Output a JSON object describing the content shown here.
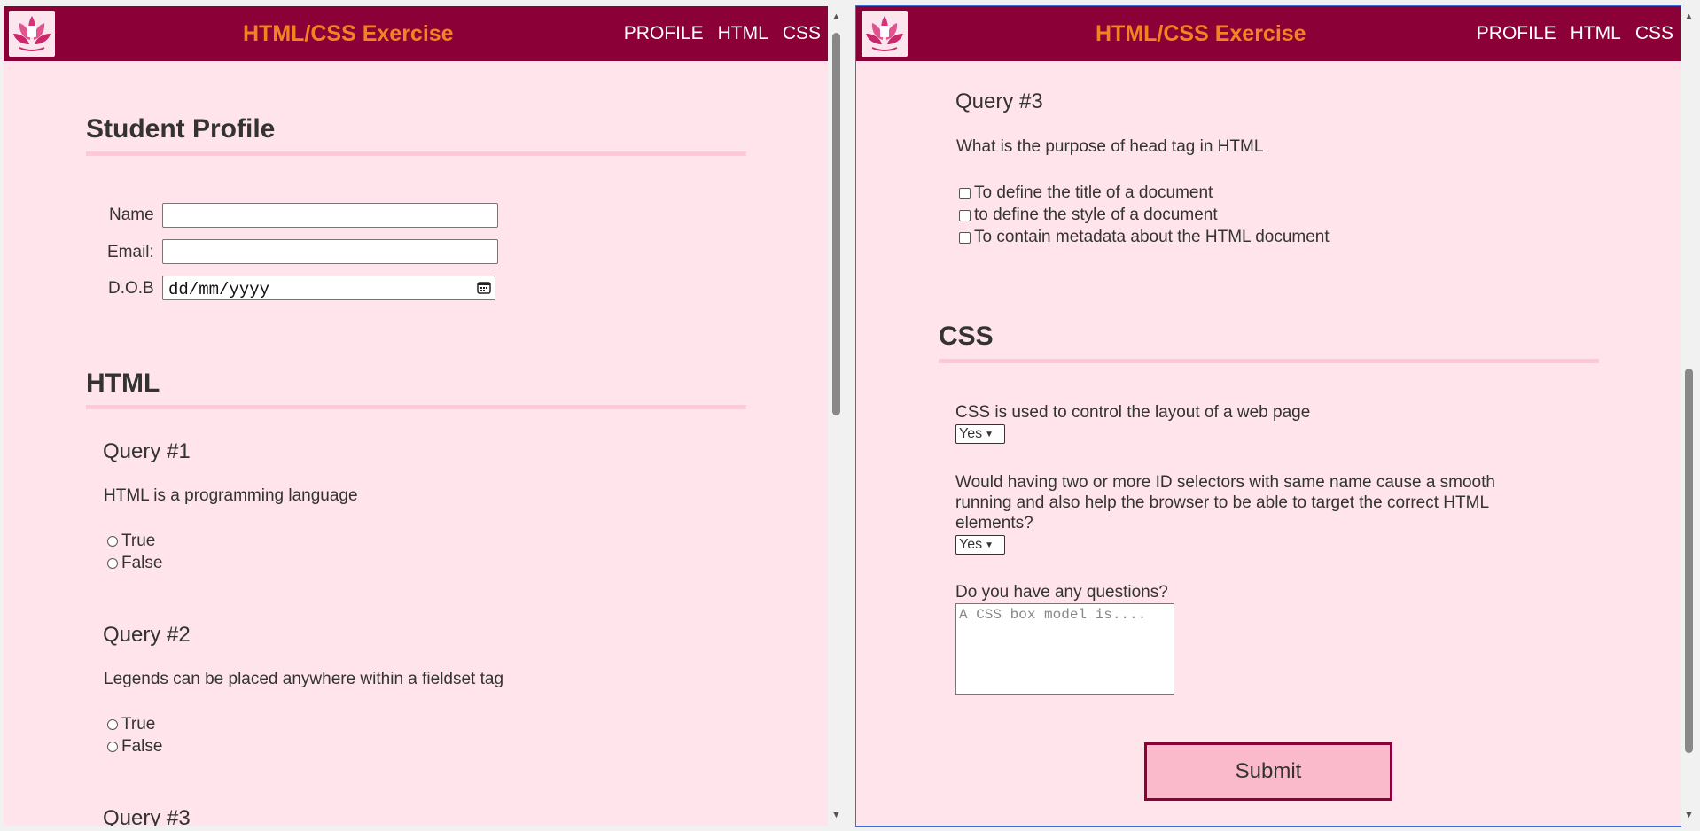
{
  "nav": {
    "title": "HTML/CSS Exercise",
    "links": [
      "PROFILE",
      "HTML",
      "CSS"
    ]
  },
  "left": {
    "profile_heading": "Student Profile",
    "fields": {
      "name_label": "Name",
      "email_label": "Email:",
      "dob_label": "D.O.B",
      "dob_value": "dd/mm/yyyy"
    },
    "html_heading": "HTML",
    "q1": {
      "title": "Query #1",
      "text": "HTML is a programming language",
      "options": [
        "True",
        "False"
      ]
    },
    "q2": {
      "title": "Query #2",
      "text": "Legends can be placed anywhere within a fieldset tag",
      "options": [
        "True",
        "False"
      ]
    },
    "q3_title": "Query #3"
  },
  "right": {
    "q3": {
      "title": "Query #3",
      "text": "What is the purpose of head tag in HTML",
      "options": [
        "To define the title of a document",
        "to define the style of a document",
        "To contain metadata about the HTML document"
      ]
    },
    "css_heading": "CSS",
    "css_q1": {
      "text": "CSS is used to control the layout of a web page",
      "selected": "Yes"
    },
    "css_q2": {
      "line1": "Would having two or more ID selectors with same name cause a smooth",
      "line2": "running and also help the browser to be able to target the correct HTML",
      "line3": "elements?",
      "selected": "Yes"
    },
    "questions_label": "Do you have any questions?",
    "textarea_placeholder": "A CSS box model is....",
    "submit_label": "Submit"
  },
  "colors": {
    "nav_bg": "#8b0036",
    "nav_title": "#f08420",
    "page_bg": "#ffe4ec",
    "rule": "#ffc8d9",
    "submit_bg": "#fbbacb"
  }
}
